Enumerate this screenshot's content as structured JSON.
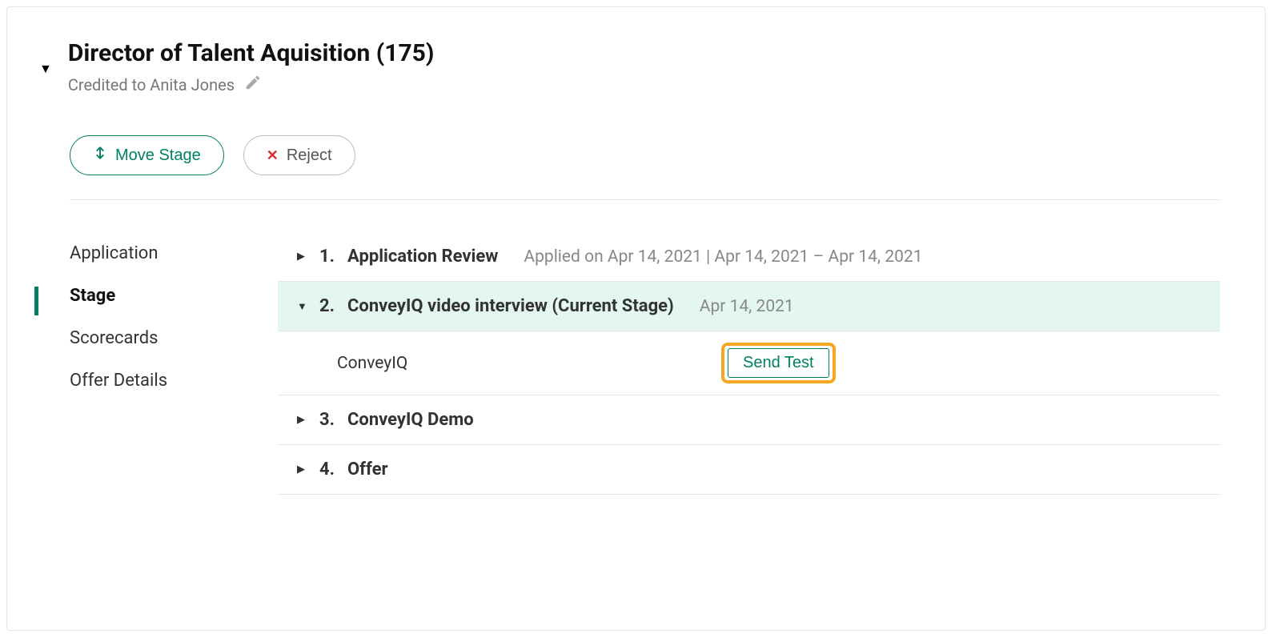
{
  "job": {
    "title": "Director of Talent Aquisition (175)",
    "credited_to": "Credited to Anita Jones"
  },
  "actions": {
    "move_stage": "Move Stage",
    "reject": "Reject"
  },
  "sidebar": {
    "items": [
      {
        "label": "Application",
        "active": false
      },
      {
        "label": "Stage",
        "active": true
      },
      {
        "label": "Scorecards",
        "active": false
      },
      {
        "label": "Offer Details",
        "active": false
      }
    ]
  },
  "stages": [
    {
      "number": "1.",
      "name": "Application Review",
      "meta": "Applied on Apr 14, 2021 | Apr 14, 2021 – Apr 14, 2021",
      "expanded": false,
      "current": false
    },
    {
      "number": "2.",
      "name": "ConveyIQ video interview (Current Stage)",
      "meta": "Apr 14, 2021",
      "expanded": true,
      "current": true,
      "sub": {
        "label": "ConveyIQ",
        "action": "Send Test"
      }
    },
    {
      "number": "3.",
      "name": "ConveyIQ Demo",
      "meta": "",
      "expanded": false,
      "current": false
    },
    {
      "number": "4.",
      "name": "Offer",
      "meta": "",
      "expanded": false,
      "current": false
    }
  ]
}
